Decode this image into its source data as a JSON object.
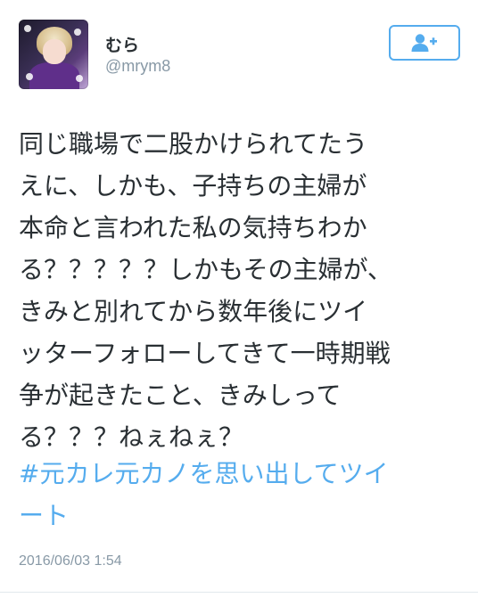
{
  "user": {
    "display_name": "むら",
    "screen_name": "@mrym8"
  },
  "follow_button": {
    "icon": "follow-user-icon",
    "accent_color": "#55acee"
  },
  "tweet": {
    "text_lines": [
      "同じ職場で二股かけられてたう",
      "えに、しかも、子持ちの主婦が",
      "本命と言われた私の気持ちわか",
      "る？？？？？しかもその主婦が、",
      "きみと別れてから数年後にツイ",
      "ッターフォローしてきて一時期戦",
      "争が起きたこと、きみしって",
      "る？？？ねぇねぇ？"
    ],
    "hashtag_lines": [
      "#元カレ元カノを思い出してツイ",
      "ート"
    ],
    "timestamp": "2016/06/03 1:54"
  },
  "colors": {
    "text": "#292f33",
    "muted": "#8899a6",
    "link": "#55acee",
    "divider": "#e1e8ed"
  }
}
